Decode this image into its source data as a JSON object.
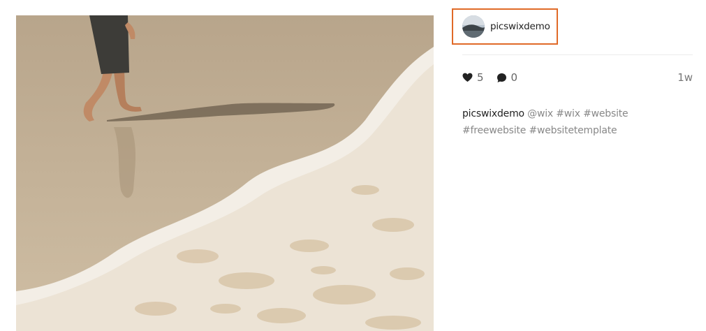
{
  "post": {
    "username": "picswixdemo",
    "likes": "5",
    "comments": "0",
    "age": "1w",
    "caption_user": "picswixdemo",
    "caption_tags": [
      "@wix",
      "#wix",
      "#website",
      "#freewebsite",
      "#websitetemplate"
    ]
  },
  "icons": {
    "like": "heart-icon",
    "comment": "comment-bubble-icon"
  },
  "colors": {
    "highlight_border": "#e06a28",
    "text_primary": "#222222",
    "text_secondary": "#888888"
  }
}
